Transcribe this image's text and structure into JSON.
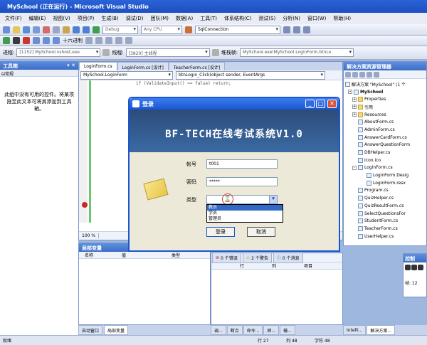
{
  "window": {
    "title": "MySchool (正在运行) - Microsoft Visual Studio"
  },
  "menu": [
    "文件(F)",
    "编辑(E)",
    "视图(V)",
    "项目(P)",
    "生成(B)",
    "调试(D)",
    "团队(M)",
    "数据(A)",
    "工具(T)",
    "体系结构(C)",
    "测试(S)",
    "分析(N)",
    "窗口(W)",
    "帮助(H)"
  ],
  "toolbar1": {
    "config": "Debug",
    "platform": "Any CPU",
    "search": "SqlConnection"
  },
  "toolbar2": {
    "hex_label": "十六进制"
  },
  "toolbar3": {
    "process_label": "进程:",
    "process": "[1152] MySchool.vshost.exe",
    "thread_label": "线程:",
    "thread": "[3820] 主线程",
    "stack_label": "堆栈帧:",
    "stack": "MySchool.exe!MySchool.LoginForm.btnLo"
  },
  "toolbox": {
    "title": "工具箱",
    "group": "常规",
    "message": "此组中没有可用的控件。将某项拖至此文本可将其添加到工具箱。"
  },
  "editor": {
    "tabs": [
      "LoginForm.cs",
      "LoginForm.cs [设计]",
      "TeacherForm.cs [设计]"
    ],
    "class_combo": "MySchool.LoginForm",
    "method_combo": "btnLogin_Click(object sender, EventArgs",
    "code_line": "if (ValidateInput() == false) return;",
    "zoom": "100 %"
  },
  "dialog": {
    "title": "登录",
    "banner": "BF-TECH在线考试系统V1.0",
    "account_label": "帐号",
    "account_value": "t001",
    "password_label": "密码",
    "password_value": "*****",
    "type_label": "类型",
    "type_options": [
      "教员",
      "学员",
      "管理员"
    ],
    "login_button": "登录",
    "cancel_button": "取消"
  },
  "locals": {
    "title": "局部变量",
    "columns": [
      "名称",
      "值",
      "类型"
    ]
  },
  "errors": {
    "errors": "0 个错误",
    "warnings": "2 个警告",
    "messages": "0 个消息",
    "columns": [
      "行",
      "列",
      "项目"
    ]
  },
  "bottom_tabs": [
    "自动窗口",
    "局部变量"
  ],
  "bottom_tabs_right": [
    "调...",
    "断点",
    "命令...",
    "即...",
    "输..."
  ],
  "solution": {
    "title": "解决方案资源管理器",
    "solution_label": "解决方案 \"MySchool\" (1 个",
    "project": "MySchool",
    "items": [
      "Properties",
      "引用",
      "Resources",
      "AboutForm.cs",
      "AdminForm.cs",
      "AnswerCardForm.cs",
      "AnswerQuestionForm",
      "DBHelper.cs",
      "Icon.ico",
      "LoginForm.cs",
      "LoginForm.Desig",
      "LoginForm.resx",
      "Program.cs",
      "QuizHelper.cs",
      "QuizResultForm.cs",
      "SelectQuestionsFor",
      "StudentForm.cs",
      "TeacherForm.cs",
      "UserHelper.cs"
    ]
  },
  "console": {
    "title": "控制",
    "value": "帧: 12"
  },
  "status": {
    "ready": "就绪",
    "row": "行 27",
    "col": "列 48",
    "char": "字符 48",
    "intellitrace": "Intelli...",
    "solution_tab": "解决方案..."
  }
}
